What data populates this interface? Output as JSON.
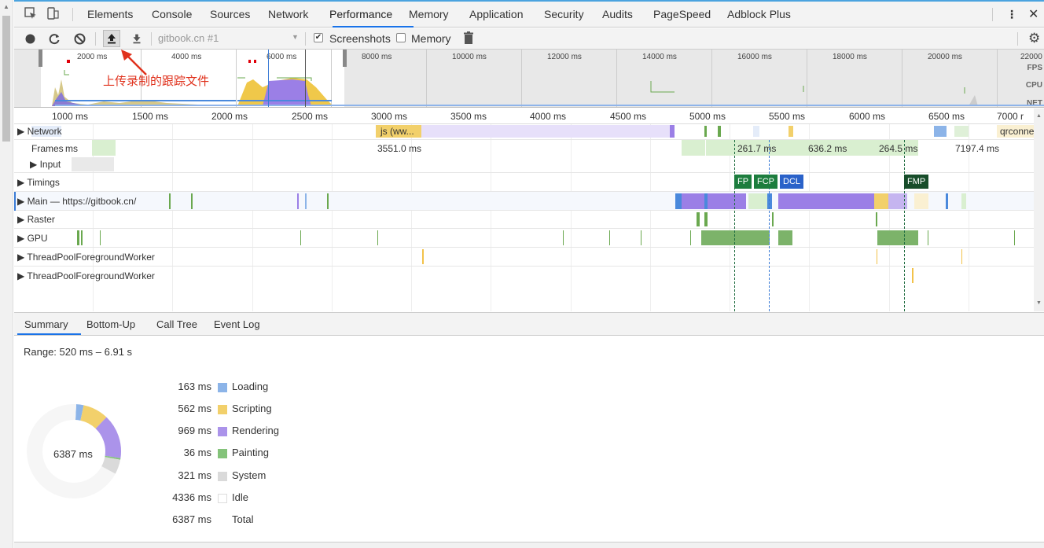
{
  "tabs": [
    "Elements",
    "Console",
    "Sources",
    "Network",
    "Performance",
    "Memory",
    "Application",
    "Security",
    "Audits",
    "PageSpeed",
    "Adblock Plus"
  ],
  "active_tab": "Performance",
  "toolbar": {
    "profile_select": "gitbook.cn #1",
    "screenshots_label": "Screenshots",
    "screenshots_checked": true,
    "memory_label": "Memory",
    "memory_checked": false
  },
  "annotation": {
    "text": "上传录制的跟踪文件",
    "color": "#e0321d"
  },
  "overview": {
    "ticks": [
      "2000 ms",
      "4000 ms",
      "6000 ms",
      "8000 ms",
      "10000 ms",
      "12000 ms",
      "14000 ms",
      "16000 ms",
      "18000 ms",
      "20000 ms",
      "22000"
    ],
    "labels": [
      "FPS",
      "CPU",
      "NET"
    ]
  },
  "ruler": [
    "1000 ms",
    "1500 ms",
    "2000 ms",
    "2500 ms",
    "3000 ms",
    "3500 ms",
    "4000 ms",
    "4500 ms",
    "5000 ms",
    "5500 ms",
    "6000 ms",
    "6500 ms",
    "7000 r"
  ],
  "tracks": {
    "network_label": "Network",
    "network_items": [
      "js (ww...",
      "qrconne"
    ],
    "frames_label": "Frames",
    "frames_ms_label": "ms",
    "frame_times": [
      "3551.0 ms",
      "261.7 ms",
      "636.2 ms",
      "264.5 ms",
      "7197.4 ms"
    ],
    "input_label": "Input",
    "timings_label": "Timings",
    "markers": [
      "FP",
      "FCP",
      "DCL",
      "FMP"
    ],
    "main_label": "Main — https://gitbook.cn/",
    "raster_label": "Raster",
    "gpu_label": "GPU",
    "worker1_label": "ThreadPoolForegroundWorker",
    "worker2_label": "ThreadPoolForegroundWorker"
  },
  "detail_tabs": [
    "Summary",
    "Bottom-Up",
    "Call Tree",
    "Event Log"
  ],
  "summary": {
    "range": "Range: 520 ms – 6.91 s",
    "center_label": "6387 ms",
    "items": [
      {
        "value": "163 ms",
        "name": "Loading",
        "color": "#8cb4e8"
      },
      {
        "value": "562 ms",
        "name": "Scripting",
        "color": "#f2d06b"
      },
      {
        "value": "969 ms",
        "name": "Rendering",
        "color": "#ab93ea"
      },
      {
        "value": "36 ms",
        "name": "Painting",
        "color": "#84c37a"
      },
      {
        "value": "321 ms",
        "name": "System",
        "color": "#dadada"
      },
      {
        "value": "4336 ms",
        "name": "Idle",
        "color": "#ffffff"
      },
      {
        "value": "6387 ms",
        "name": "Total",
        "color": "none"
      }
    ]
  }
}
